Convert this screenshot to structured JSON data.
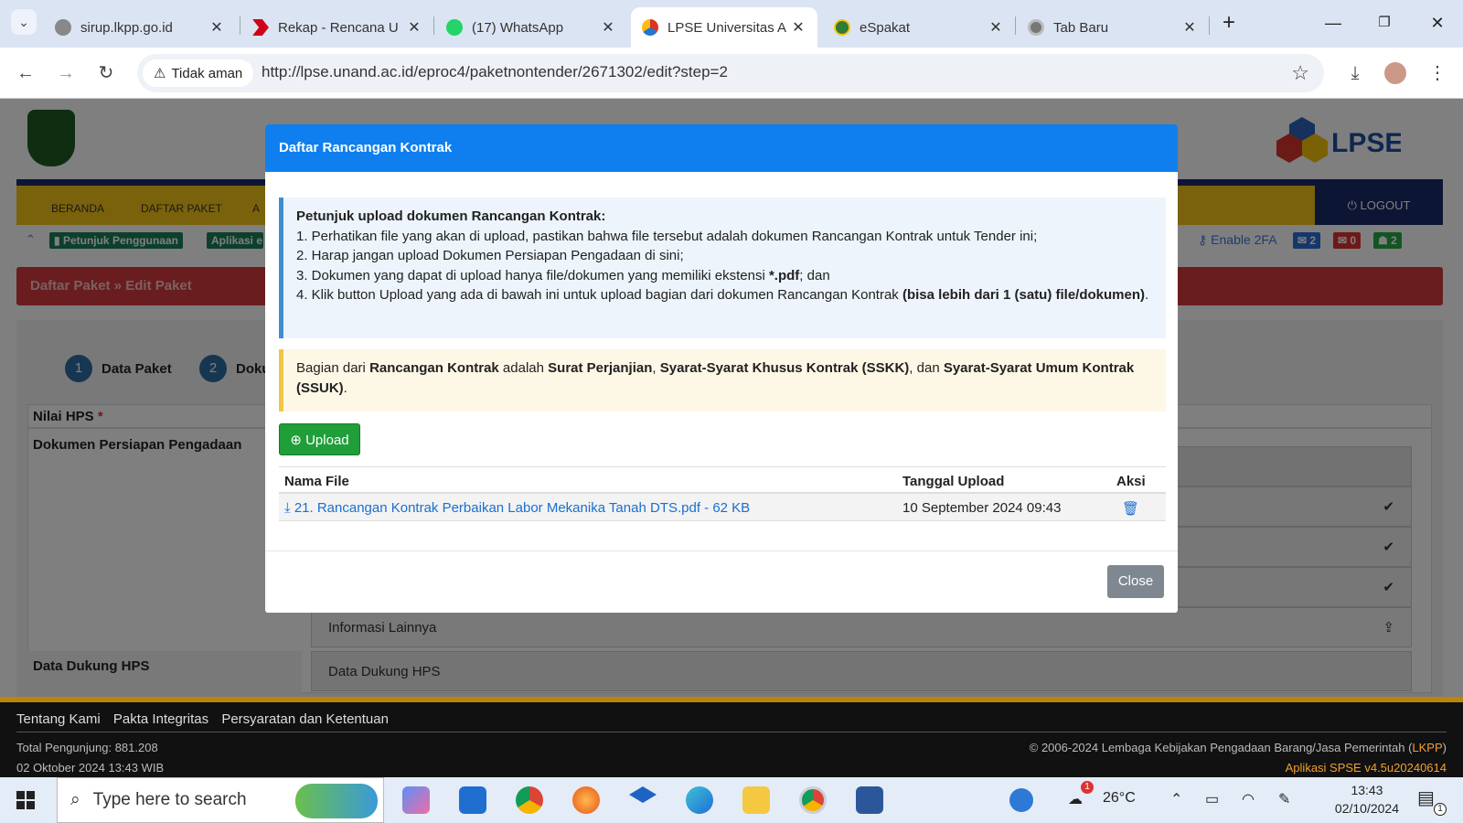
{
  "browser": {
    "tabs": [
      {
        "title": "sirup.lkpp.go.id",
        "icon": "globe-icon"
      },
      {
        "title": "Rekap - Rencana U",
        "icon": "red-chevron-icon"
      },
      {
        "title": "(17) WhatsApp",
        "icon": "whatsapp-icon"
      },
      {
        "title": "LPSE Universitas A",
        "icon": "lpse-icon",
        "active": true
      },
      {
        "title": "eSpakat",
        "icon": "espakat-icon"
      },
      {
        "title": "Tab Baru",
        "icon": "chrome-icon"
      }
    ],
    "security_label": "Tidak aman",
    "url": "http://lpse.unand.ac.id/eproc4/paketnontender/2671302/edit?step=2"
  },
  "site": {
    "nav": [
      "BERANDA",
      "DAFTAR PAKET",
      "A"
    ],
    "logout": "LOGOUT",
    "subnav": {
      "petunjuk": "Petunjuk Penggunaan",
      "aplikasi": "Aplikasi e",
      "enable2fa": "Enable 2FA",
      "partial": "n |",
      "badge_mail": "2",
      "badge_inbox": "0",
      "badge_other": "2"
    },
    "breadcrumb": {
      "item1": "Daftar Paket",
      "sep": "»",
      "item2": "Edit Paket"
    },
    "steps": [
      {
        "num": "1",
        "label": "Data Paket"
      },
      {
        "num": "2",
        "label": "Doku"
      }
    ],
    "fields": {
      "nilai_hps": "Nilai HPS",
      "req": "*",
      "dokumen": "Dokumen Persiapan Pengadaan",
      "data_dukung": "Data Dukung HPS"
    },
    "doc_lines": {
      "informasi": "Informasi Lainnya",
      "data_dukung": "Data Dukung HPS"
    }
  },
  "modal": {
    "title": "Daftar Rancangan Kontrak",
    "info": {
      "heading": "Petunjuk upload dokumen Rancangan Kontrak:",
      "item1": "1. Perhatikan file yang akan di upload, pastikan bahwa file tersebut adalah dokumen Rancangan Kontrak untuk Tender ini;",
      "item2": "2. Harap jangan upload Dokumen Persiapan Pengadaan di sini;",
      "item3_a": "3. Dokumen yang dapat di upload hanya file/dokumen yang memiliki ekstensi ",
      "item3_b": "*.pdf",
      "item3_c": "; dan",
      "item4_a": "4. Klik button Upload yang ada di bawah ini untuk upload bagian dari dokumen Rancangan Kontrak ",
      "item4_b": "(bisa lebih dari 1 (satu) file/dokumen)",
      "item4_c": "."
    },
    "warn": {
      "t1": "Bagian dari ",
      "b1": "Rancangan Kontrak",
      "t2": " adalah ",
      "b2": "Surat Perjanjian",
      "t3": ", ",
      "b3": "Syarat-Syarat Khusus Kontrak (SSKK)",
      "t4": ", dan ",
      "b4": "Syarat-Syarat Umum Kontrak (SSUK)",
      "t5": "."
    },
    "upload_label": "Upload",
    "table": {
      "headers": [
        "Nama File",
        "Tanggal Upload",
        "Aksi"
      ],
      "rows": [
        {
          "file": "21. Rancangan Kontrak Perbaikan Labor Mekanika Tanah DTS.pdf - 62 KB",
          "date": "10 September 2024 09:43"
        }
      ]
    },
    "close_label": "Close"
  },
  "footer": {
    "links": [
      "Tentang Kami",
      "Pakta Integritas",
      "Persyaratan dan Ketentuan"
    ],
    "visitors": "Total Pengunjung: 881.208",
    "datetime": "02 Oktober 2024 13:43 WIB",
    "copyright_a": "© 2006-2024 Lembaga Kebijakan Pengadaan Barang/Jasa Pemerintah (",
    "copyright_b": "LKPP",
    "copyright_c": ")",
    "version": "Aplikasi SPSE v4.5u20240614"
  },
  "taskbar": {
    "search_placeholder": "Type here to search",
    "temp": "26°C",
    "weather_badge": "1",
    "time": "13:43",
    "date": "02/10/2024",
    "notif_count": "1"
  },
  "colors": {
    "modal_header": "#0f7fef",
    "navbar_yellow": "#f5c518",
    "breadcrumb_red": "#d33b3f",
    "upload_green": "#1f9e3a"
  }
}
